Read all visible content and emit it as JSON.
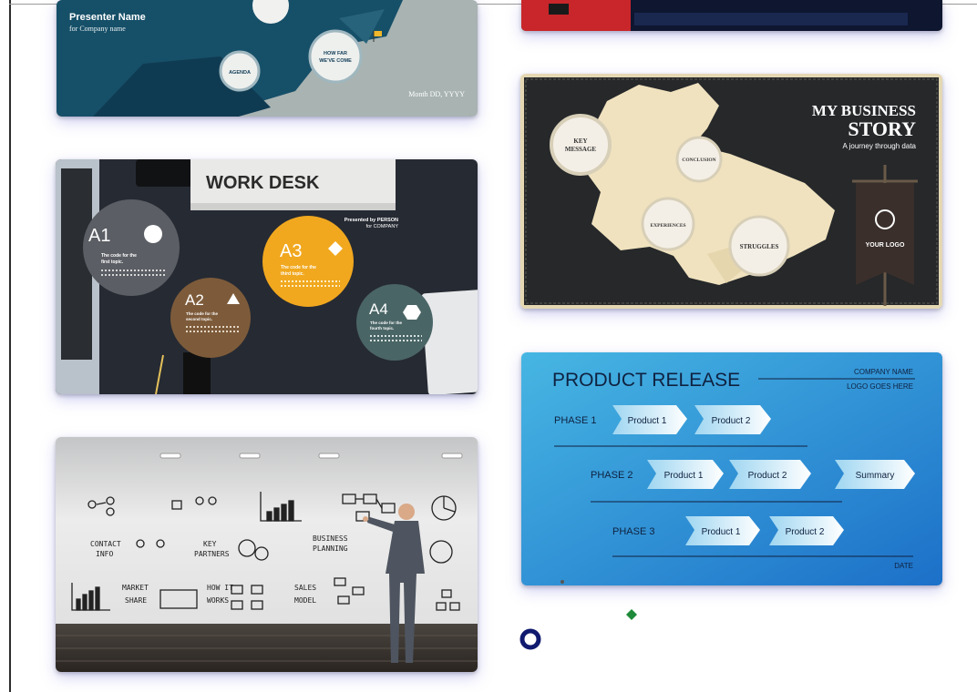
{
  "cards": {
    "presenter": {
      "presenter_name": "Presenter Name",
      "company": "for Company name",
      "agenda": "AGENDA",
      "how_far_1": "HOW FAR",
      "how_far_2": "WE'VE COME",
      "date": "Month DD, YYYY"
    },
    "work_desk": {
      "title": "WORK DESK",
      "presented_by_1": "Presented by PERSON",
      "presented_by_2": "for COMPANY",
      "items": [
        {
          "label": "A1",
          "text_1": "The code for the",
          "text_2": "first topic."
        },
        {
          "label": "A2",
          "text_1": "The code for the",
          "text_2": "second topic."
        },
        {
          "label": "A3",
          "text_1": "The code for the",
          "text_2": "third topic."
        },
        {
          "label": "A4",
          "text_1": "The code for the",
          "text_2": "fourth topic."
        }
      ]
    },
    "whiteboard": {
      "contact_1": "CONTACT",
      "contact_2": "INFO",
      "partners_1": "KEY",
      "partners_2": "PARTNERS",
      "business_1": "BUSINESS",
      "business_2": "PLANNING",
      "market_1": "MARKET",
      "market_2": "SHARE",
      "how_1": "HOW IT",
      "how_2": "WORKS",
      "sales_1": "SALES",
      "sales_2": "MODEL"
    },
    "business_story": {
      "title_1": "MY BUSINESS",
      "title_2": "STORY",
      "subtitle": "A journey through data",
      "key_1": "KEY",
      "key_2": "MESSAGE",
      "conclusion": "CONCLUSION",
      "experiences": "EXPERIENCES",
      "struggles": "STRUGGLES",
      "logo": "YOUR LOGO"
    },
    "product_release": {
      "title": "PRODUCT RELEASE",
      "company": "COMPANY NAME",
      "logo": "LOGO GOES HERE",
      "phase1": "PHASE 1",
      "phase2": "PHASE 2",
      "phase3": "PHASE 3",
      "product1": "Product 1",
      "product2": "Product 2",
      "summary": "Summary",
      "date": "DATE"
    }
  },
  "colors": {
    "accent_green": "#1e8a3a",
    "accent_navy": "#101a6e"
  }
}
